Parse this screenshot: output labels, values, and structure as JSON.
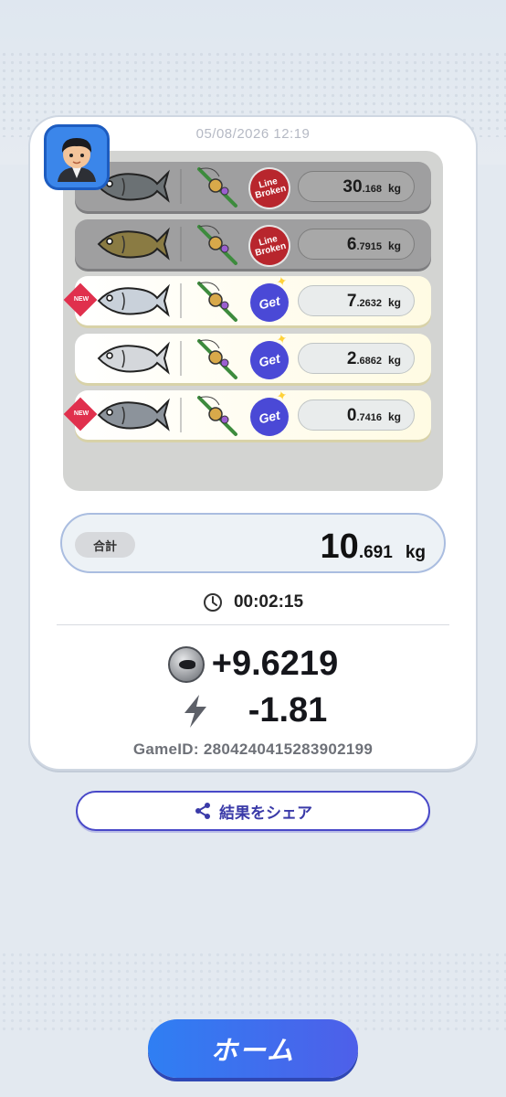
{
  "timestamp": "05/08/2026 12:19",
  "catches": [
    {
      "status": "broken",
      "status_text": "Line Broken",
      "new": false,
      "weight_int": "30",
      "weight_dec": ".168",
      "unit": "kg",
      "fish_color": "#6b7174"
    },
    {
      "status": "broken",
      "status_text": "Line Broken",
      "new": false,
      "weight_int": "6",
      "weight_dec": ".7915",
      "unit": "kg",
      "fish_color": "#8a7b43"
    },
    {
      "status": "get",
      "status_text": "Get",
      "new": true,
      "new_text": "NEW",
      "weight_int": "7",
      "weight_dec": ".2632",
      "unit": "kg",
      "fish_color": "#c9d1da"
    },
    {
      "status": "get",
      "status_text": "Get",
      "new": false,
      "weight_int": "2",
      "weight_dec": ".6862",
      "unit": "kg",
      "fish_color": "#d4d7db"
    },
    {
      "status": "get",
      "status_text": "Get",
      "new": true,
      "new_text": "NEW",
      "weight_int": "0",
      "weight_dec": ".7416",
      "unit": "kg",
      "fish_color": "#8c939b"
    }
  ],
  "total": {
    "label": "合計",
    "int": "10",
    "dec": ".691",
    "unit": "kg"
  },
  "timer": "00:02:15",
  "rewards": {
    "coin": "+9.6219",
    "energy": "-1.81"
  },
  "game_id": "GameID: 2804240415283902199",
  "share_label": "結果をシェア",
  "home_label": "ホーム",
  "colors": {
    "accent": "#4848c8",
    "home": "#2f7ff3",
    "broken": "#b8262d",
    "get": "#4a49d6"
  }
}
